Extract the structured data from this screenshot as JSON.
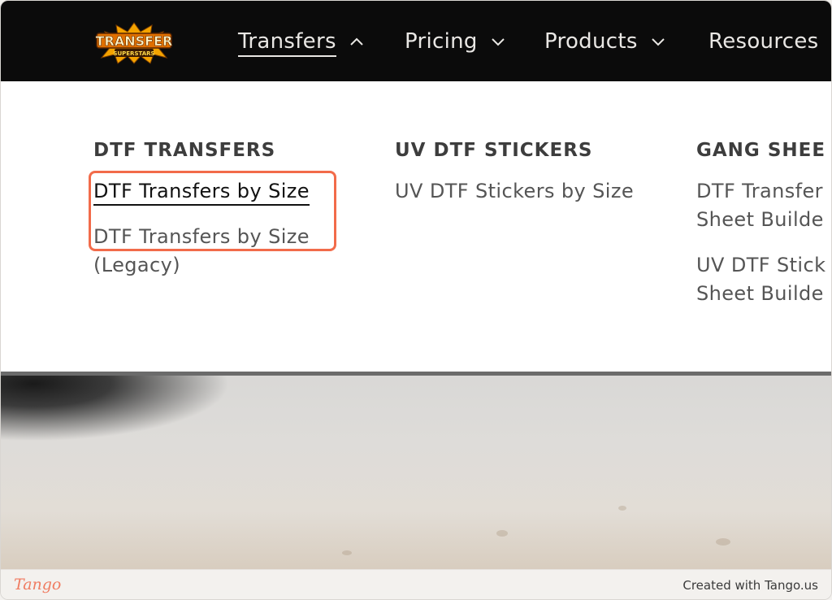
{
  "navbar": {
    "logo": {
      "text_top": "TRANSFER",
      "text_bottom": "SUPERSTARS"
    },
    "items": [
      {
        "label": "Transfers",
        "chevron": "up"
      },
      {
        "label": "Pricing",
        "chevron": "down"
      },
      {
        "label": "Products",
        "chevron": "down"
      },
      {
        "label": "Resources"
      }
    ]
  },
  "dropdown": {
    "columns": [
      {
        "title": "DTF TRANSFERS",
        "links": [
          "DTF Transfers by Size",
          "DTF Transfers by Size (Legacy)"
        ]
      },
      {
        "title": "UV DTF STICKERS",
        "links": [
          "UV DTF Stickers by Size"
        ]
      },
      {
        "title": "GANG SHEE",
        "links": [
          "DTF Transfer Sheet Builde",
          "UV DTF Stick Sheet Builde"
        ]
      }
    ]
  },
  "footer": {
    "brand": "Tango",
    "created_text": "Created with Tango.us"
  },
  "colors": {
    "navbar_bg": "#0b0b0b",
    "highlight": "#f26b4a",
    "tango_brand": "#f07c61"
  }
}
